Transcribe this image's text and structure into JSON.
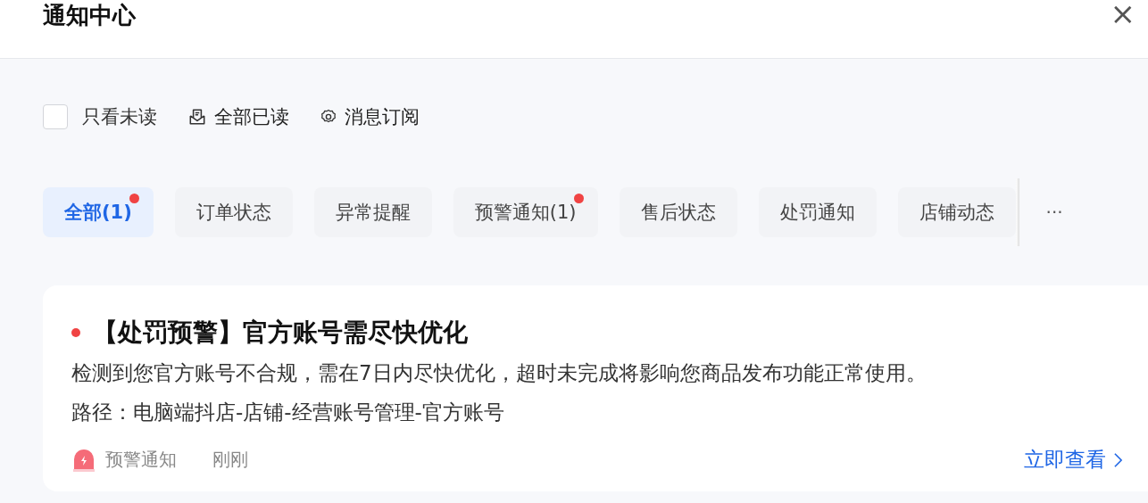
{
  "header": {
    "title": "通知中心",
    "close": "×"
  },
  "toolbar": {
    "unread_only": {
      "label": "只看未读",
      "checked": false
    },
    "mark_all_read": "全部已读",
    "subscribe": "消息订阅"
  },
  "tabs": [
    {
      "label": "全部(1)",
      "selected": true,
      "dot": true
    },
    {
      "label": "订单状态",
      "selected": false,
      "dot": false
    },
    {
      "label": "异常提醒",
      "selected": false,
      "dot": false
    },
    {
      "label": "预警通知(1)",
      "selected": false,
      "dot": true
    },
    {
      "label": "售后状态",
      "selected": false,
      "dot": false
    },
    {
      "label": "处罚通知",
      "selected": false,
      "dot": false
    },
    {
      "label": "店铺动态",
      "selected": false,
      "dot": false
    }
  ],
  "more": "···",
  "notices": [
    {
      "unread": true,
      "title": "【处罚预警】官方账号需尽快优化",
      "body": "检测到您官方账号不合规，需在7日内尽快优化，超时未完成将影响您商品发布功能正常使用。",
      "path": "路径：电脑端抖店-店铺-经营账号管理-官方账号",
      "category": "预警通知",
      "time": "刚刚",
      "action": "立即查看"
    }
  ]
}
